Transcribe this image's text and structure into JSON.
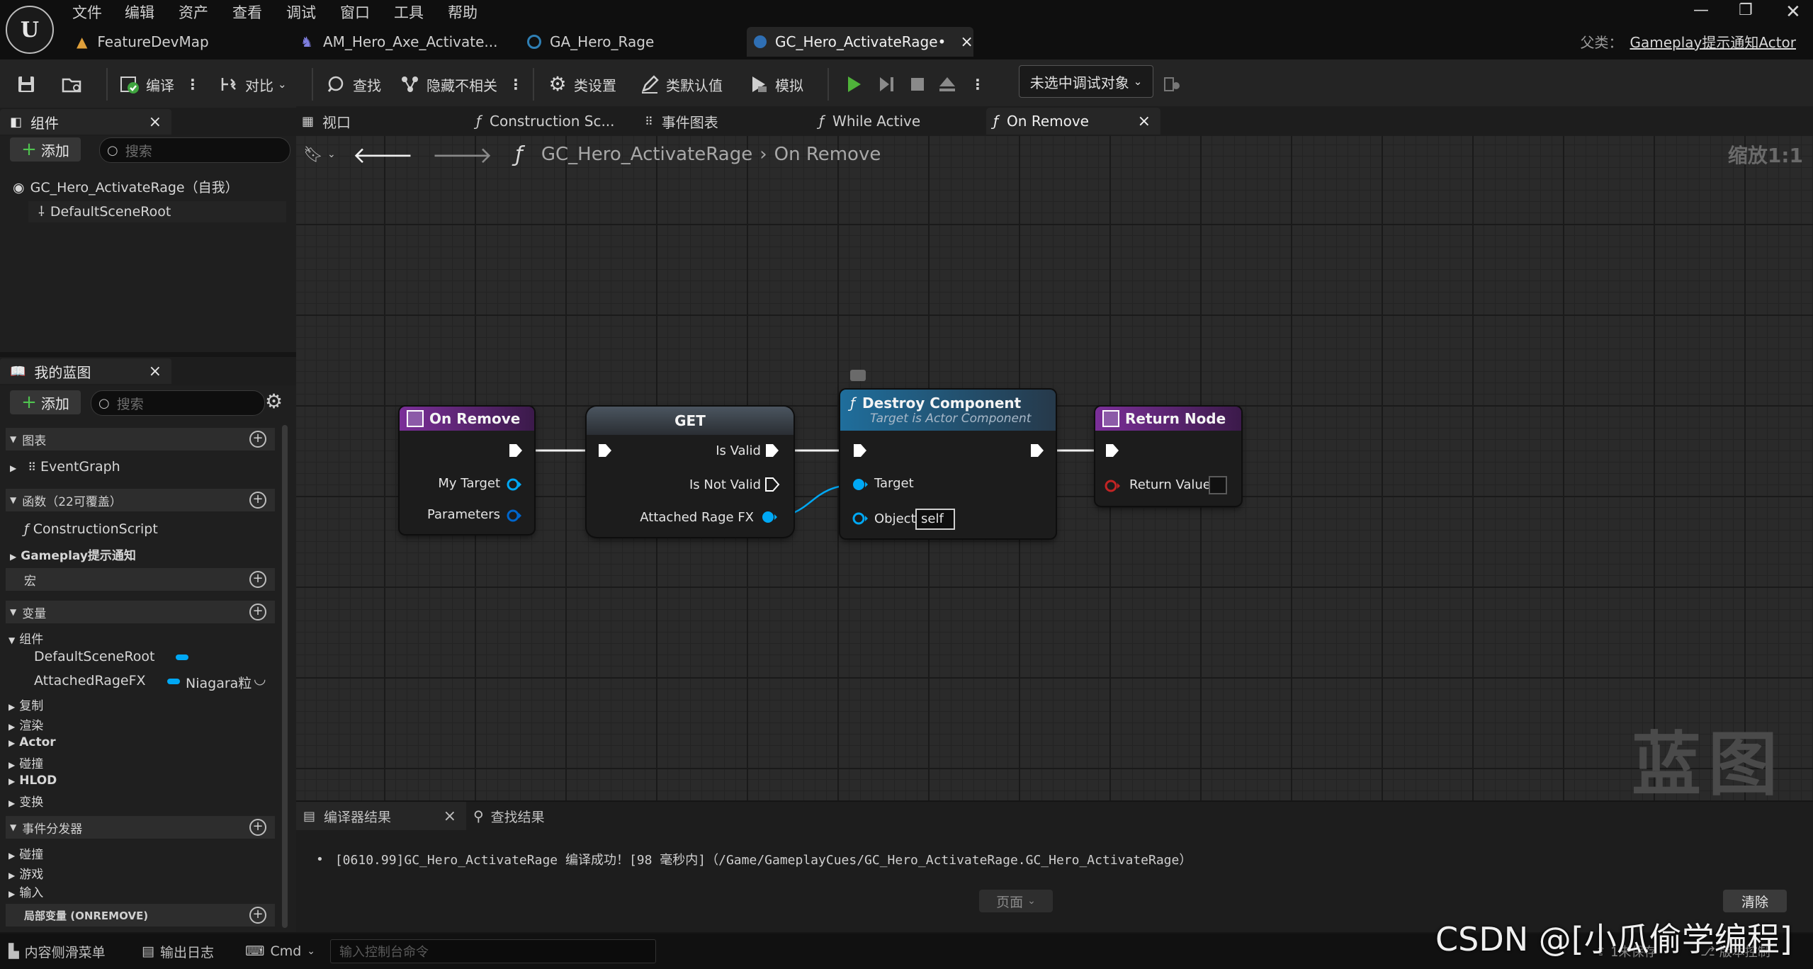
{
  "menu": [
    "文件",
    "编辑",
    "资产",
    "查看",
    "调试",
    "窗口",
    "工具",
    "帮助"
  ],
  "doc_tabs": [
    {
      "label": "FeatureDevMap"
    },
    {
      "label": "AM_Hero_Axe_Activate..."
    },
    {
      "label": "GA_Hero_Rage"
    },
    {
      "label": "GC_Hero_ActivateRage•",
      "close": "×"
    }
  ],
  "parent_class": {
    "label": "父类：",
    "value": "Gameplay提示通知Actor"
  },
  "toolbar": {
    "compile": "编译",
    "diff": "对比",
    "find": "查找",
    "hide_unrelated": "隐藏不相关",
    "class_settings": "类设置",
    "class_defaults": "类默认值",
    "simulate": "模拟",
    "debug_object": "未选中调试对象"
  },
  "components_panel": {
    "title": "组件",
    "close": "×",
    "add": "添加",
    "search_placeholder": "搜索",
    "root": "GC_Hero_ActivateRage（自我）",
    "child": "DefaultSceneRoot"
  },
  "my_blueprint": {
    "title": "我的蓝图",
    "close": "×",
    "add": "添加",
    "search_placeholder": "搜索",
    "graphs_header": "图表",
    "event_graph": "EventGraph",
    "functions_header": "函数（22可覆盖）",
    "construction_script": "ConstructionScript",
    "gameplay_notify": "Gameplay提示通知",
    "macros_header": "宏",
    "variables_header": "变量",
    "components_group": "组件",
    "var_default_scene_root": "DefaultSceneRoot",
    "var_attached": "AttachedRageFX",
    "var_attached_type": "Niagara粒",
    "categories": [
      "复制",
      "渲染",
      "Actor",
      "碰撞",
      "HLOD",
      "变换"
    ],
    "dispatchers_header": "事件分发器",
    "dispatcher_categories": [
      "碰撞",
      "游戏",
      "输入"
    ],
    "local_vars_header": "局部变量 (ONREMOVE)"
  },
  "graph_tabs": [
    "视口",
    "Construction Sc...",
    "事件图表",
    "While Active",
    "On Remove"
  ],
  "graph_tab_close": "×",
  "breadcrumb": {
    "root": "GC_Hero_ActivateRage",
    "current": "On Remove",
    "zoom": "缩放1:1"
  },
  "watermark": "蓝图",
  "nodes": {
    "on_remove": {
      "title": "On Remove",
      "pins": [
        "My Target",
        "Parameters"
      ]
    },
    "get": {
      "title": "GET",
      "pins": [
        "Is Valid",
        "Is Not Valid",
        "Attached Rage FX"
      ]
    },
    "destroy": {
      "title": "Destroy Component",
      "subtitle": "Target is Actor Component",
      "pins": [
        "Target",
        "Object"
      ],
      "object_value": "self"
    },
    "return": {
      "title": "Return Node",
      "pins": [
        "Return Value"
      ]
    }
  },
  "bottom_panel": {
    "tab_compiler": "编译器结果",
    "tab_close": "×",
    "tab_find": "查找结果",
    "log": "[0610.99]GC_Hero_ActivateRage 编译成功！[98 毫秒内]（/Game/GameplayCues/GC_Hero_ActivateRage.GC_Hero_ActivateRage）",
    "page": "页面",
    "clear": "清除"
  },
  "statusbar": {
    "content_drawer": "内容侧滑菜单",
    "output_log": "输出日志",
    "cmd": "Cmd",
    "console_placeholder": "输入控制台命令",
    "unsaved": "1未保存",
    "revision": "版本控制",
    "watermark": "CSDN @[小瓜偷学编程]"
  },
  "colors": {
    "exec": "#ffffff",
    "object_pin": "#00a8f4",
    "function_header": "#1f6e9c",
    "event_header": "#7b2f99",
    "return_pin": "#c22424"
  }
}
